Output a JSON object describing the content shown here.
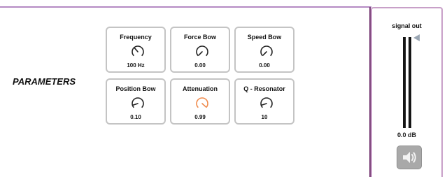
{
  "section": {
    "title": "PARAMETERS"
  },
  "dials": [
    {
      "name": "Frequency",
      "value": "100 Hz",
      "level": 0.35,
      "highlight": false
    },
    {
      "name": "Force Bow",
      "value": "0.00",
      "level": 0.0,
      "highlight": false
    },
    {
      "name": "Speed Bow",
      "value": "0.00",
      "level": 0.0,
      "highlight": false
    },
    {
      "name": "Position Bow",
      "value": "0.10",
      "level": 0.1,
      "highlight": false
    },
    {
      "name": "Attenuation",
      "value": "0.99",
      "level": 0.99,
      "highlight": true
    },
    {
      "name": "Q - Resonator",
      "value": "10",
      "level": 0.1,
      "highlight": false
    }
  ],
  "meter": {
    "title": "signal out",
    "db": "0.0 dB",
    "mute_icon": "speaker-icon"
  },
  "colors": {
    "accent": "#f08a4b",
    "panel_border": "#c8a0c8",
    "rule": "#b58ac3"
  }
}
